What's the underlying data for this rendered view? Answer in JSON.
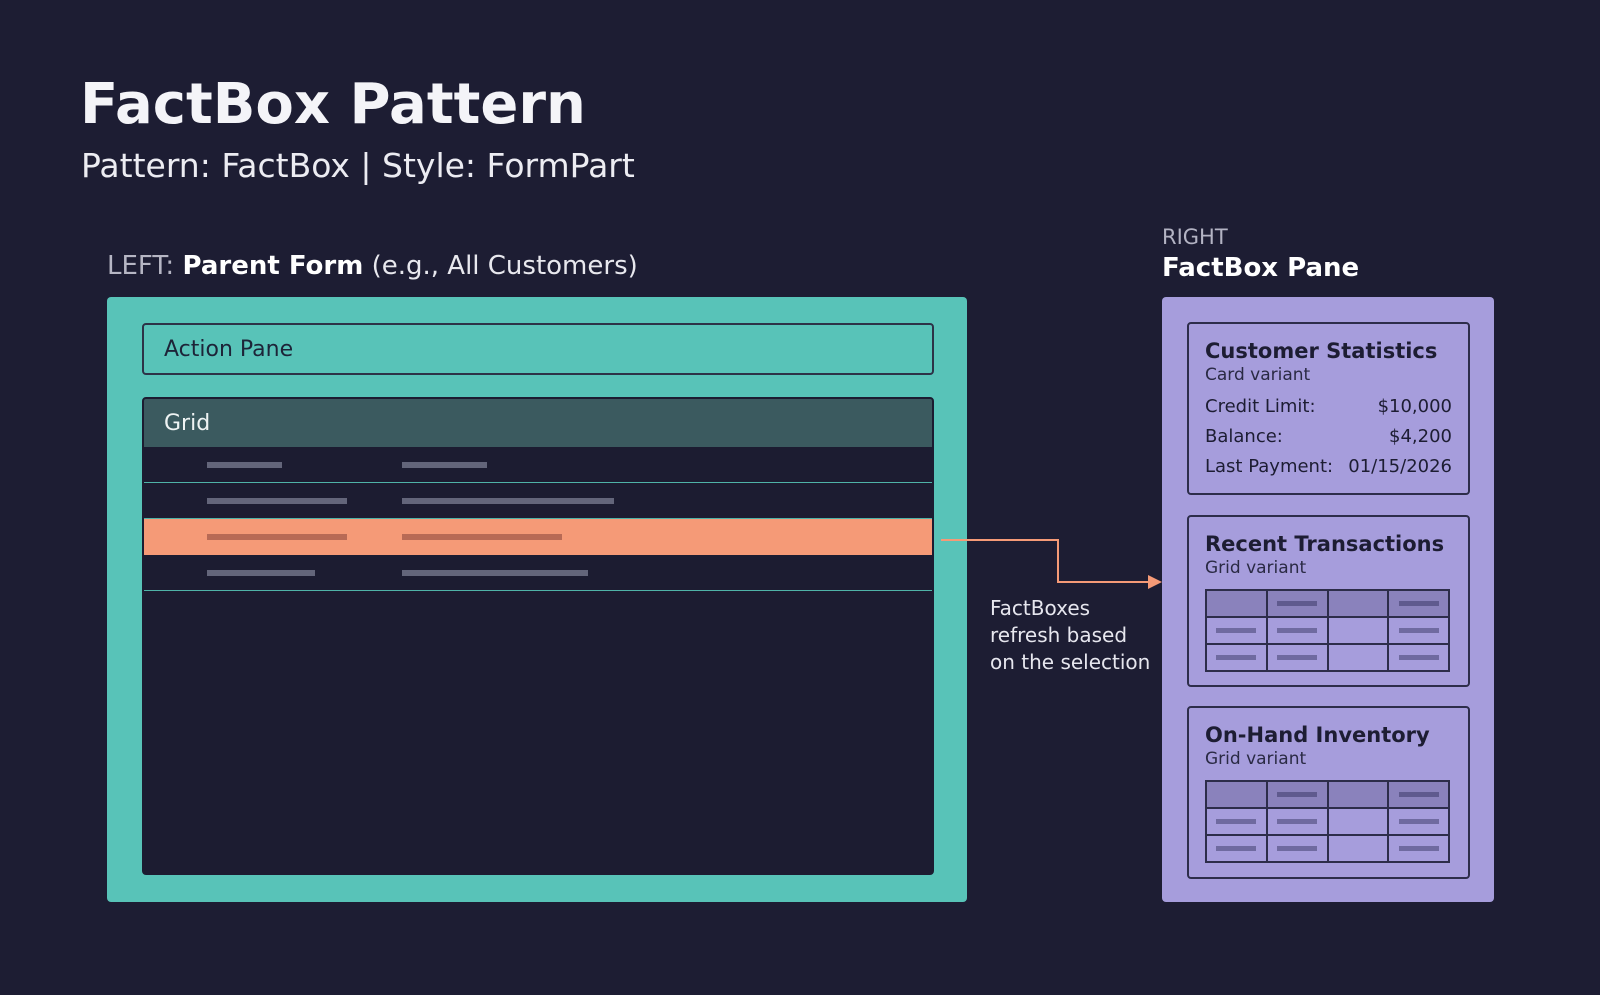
{
  "header": {
    "title": "FactBox Pattern",
    "subtitle": "Pattern: FactBox | Style: FormPart"
  },
  "left_section": {
    "prefix": "LEFT:",
    "name": "Parent Form",
    "example": "(e.g., All Customers)"
  },
  "right_section": {
    "prefix": "RIGHT",
    "name": "FactBox Pane"
  },
  "parent_form": {
    "action_pane_label": "Action Pane",
    "grid_label": "Grid",
    "selected_row_index": 2,
    "row_count": 4
  },
  "connector_note": {
    "lines": [
      "FactBoxes",
      "refresh based",
      "on the selection"
    ]
  },
  "factboxes": [
    {
      "title": "Customer Statistics",
      "variant": "Card variant",
      "stats": [
        {
          "label": "Credit Limit:",
          "value": "$10,000"
        },
        {
          "label": "Balance:",
          "value": "$4,200"
        },
        {
          "label": "Last Payment:",
          "value": "01/15/2026"
        }
      ]
    },
    {
      "title": "Recent Transactions",
      "variant": "Grid variant"
    },
    {
      "title": "On-Hand Inventory",
      "variant": "Grid variant"
    }
  ],
  "colors": {
    "background": "#1d1d33",
    "parent_form": "#58c3b8",
    "selected_row": "#f59a77",
    "factbox_pane": "#a69ddc",
    "connector": "#f59a77"
  }
}
